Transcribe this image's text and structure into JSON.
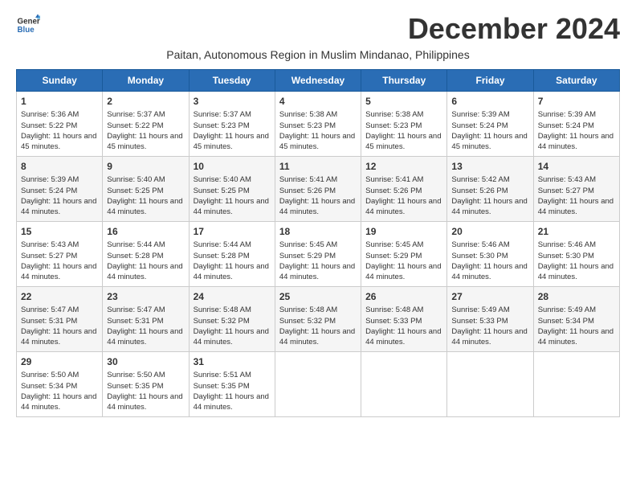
{
  "logo": {
    "line1": "General",
    "line2": "Blue"
  },
  "title": "December 2024",
  "location": "Paitan, Autonomous Region in Muslim Mindanao, Philippines",
  "days_of_week": [
    "Sunday",
    "Monday",
    "Tuesday",
    "Wednesday",
    "Thursday",
    "Friday",
    "Saturday"
  ],
  "weeks": [
    [
      {
        "day": 1,
        "sunrise": "5:36 AM",
        "sunset": "5:22 PM",
        "daylight": "11 hours and 45 minutes."
      },
      {
        "day": 2,
        "sunrise": "5:37 AM",
        "sunset": "5:22 PM",
        "daylight": "11 hours and 45 minutes."
      },
      {
        "day": 3,
        "sunrise": "5:37 AM",
        "sunset": "5:23 PM",
        "daylight": "11 hours and 45 minutes."
      },
      {
        "day": 4,
        "sunrise": "5:38 AM",
        "sunset": "5:23 PM",
        "daylight": "11 hours and 45 minutes."
      },
      {
        "day": 5,
        "sunrise": "5:38 AM",
        "sunset": "5:23 PM",
        "daylight": "11 hours and 45 minutes."
      },
      {
        "day": 6,
        "sunrise": "5:39 AM",
        "sunset": "5:24 PM",
        "daylight": "11 hours and 45 minutes."
      },
      {
        "day": 7,
        "sunrise": "5:39 AM",
        "sunset": "5:24 PM",
        "daylight": "11 hours and 44 minutes."
      }
    ],
    [
      {
        "day": 8,
        "sunrise": "5:39 AM",
        "sunset": "5:24 PM",
        "daylight": "11 hours and 44 minutes."
      },
      {
        "day": 9,
        "sunrise": "5:40 AM",
        "sunset": "5:25 PM",
        "daylight": "11 hours and 44 minutes."
      },
      {
        "day": 10,
        "sunrise": "5:40 AM",
        "sunset": "5:25 PM",
        "daylight": "11 hours and 44 minutes."
      },
      {
        "day": 11,
        "sunrise": "5:41 AM",
        "sunset": "5:26 PM",
        "daylight": "11 hours and 44 minutes."
      },
      {
        "day": 12,
        "sunrise": "5:41 AM",
        "sunset": "5:26 PM",
        "daylight": "11 hours and 44 minutes."
      },
      {
        "day": 13,
        "sunrise": "5:42 AM",
        "sunset": "5:26 PM",
        "daylight": "11 hours and 44 minutes."
      },
      {
        "day": 14,
        "sunrise": "5:43 AM",
        "sunset": "5:27 PM",
        "daylight": "11 hours and 44 minutes."
      }
    ],
    [
      {
        "day": 15,
        "sunrise": "5:43 AM",
        "sunset": "5:27 PM",
        "daylight": "11 hours and 44 minutes."
      },
      {
        "day": 16,
        "sunrise": "5:44 AM",
        "sunset": "5:28 PM",
        "daylight": "11 hours and 44 minutes."
      },
      {
        "day": 17,
        "sunrise": "5:44 AM",
        "sunset": "5:28 PM",
        "daylight": "11 hours and 44 minutes."
      },
      {
        "day": 18,
        "sunrise": "5:45 AM",
        "sunset": "5:29 PM",
        "daylight": "11 hours and 44 minutes."
      },
      {
        "day": 19,
        "sunrise": "5:45 AM",
        "sunset": "5:29 PM",
        "daylight": "11 hours and 44 minutes."
      },
      {
        "day": 20,
        "sunrise": "5:46 AM",
        "sunset": "5:30 PM",
        "daylight": "11 hours and 44 minutes."
      },
      {
        "day": 21,
        "sunrise": "5:46 AM",
        "sunset": "5:30 PM",
        "daylight": "11 hours and 44 minutes."
      }
    ],
    [
      {
        "day": 22,
        "sunrise": "5:47 AM",
        "sunset": "5:31 PM",
        "daylight": "11 hours and 44 minutes."
      },
      {
        "day": 23,
        "sunrise": "5:47 AM",
        "sunset": "5:31 PM",
        "daylight": "11 hours and 44 minutes."
      },
      {
        "day": 24,
        "sunrise": "5:48 AM",
        "sunset": "5:32 PM",
        "daylight": "11 hours and 44 minutes."
      },
      {
        "day": 25,
        "sunrise": "5:48 AM",
        "sunset": "5:32 PM",
        "daylight": "11 hours and 44 minutes."
      },
      {
        "day": 26,
        "sunrise": "5:48 AM",
        "sunset": "5:33 PM",
        "daylight": "11 hours and 44 minutes."
      },
      {
        "day": 27,
        "sunrise": "5:49 AM",
        "sunset": "5:33 PM",
        "daylight": "11 hours and 44 minutes."
      },
      {
        "day": 28,
        "sunrise": "5:49 AM",
        "sunset": "5:34 PM",
        "daylight": "11 hours and 44 minutes."
      }
    ],
    [
      {
        "day": 29,
        "sunrise": "5:50 AM",
        "sunset": "5:34 PM",
        "daylight": "11 hours and 44 minutes."
      },
      {
        "day": 30,
        "sunrise": "5:50 AM",
        "sunset": "5:35 PM",
        "daylight": "11 hours and 44 minutes."
      },
      {
        "day": 31,
        "sunrise": "5:51 AM",
        "sunset": "5:35 PM",
        "daylight": "11 hours and 44 minutes."
      },
      null,
      null,
      null,
      null
    ]
  ]
}
